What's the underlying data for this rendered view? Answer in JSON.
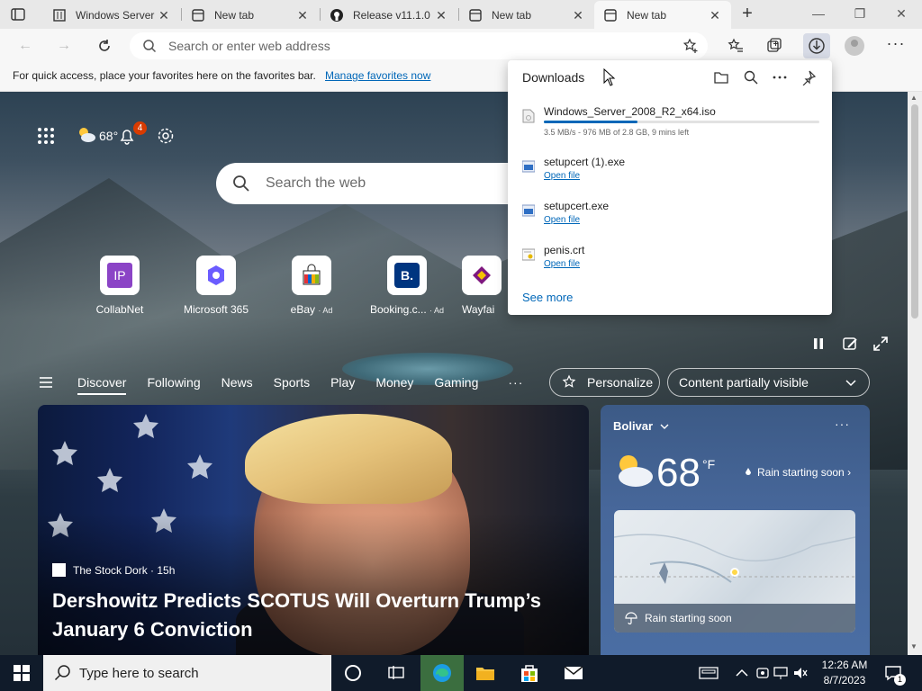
{
  "browser": {
    "tabs": [
      {
        "label": "Windows Server",
        "icon": "building-icon",
        "active": false
      },
      {
        "label": "New tab",
        "icon": "newtab-icon",
        "active": false
      },
      {
        "label": "Release v11.1.0",
        "icon": "github-icon",
        "active": false
      },
      {
        "label": "New tab",
        "icon": "newtab-icon",
        "active": false
      },
      {
        "label": "New tab",
        "icon": "newtab-icon",
        "active": true
      }
    ],
    "address_placeholder": "Search or enter web address",
    "favorites_bar": {
      "message": "For quick access, place your favorites here on the favorites bar.",
      "link": "Manage favorites now"
    },
    "accent": "#0067b8"
  },
  "downloads": {
    "title": "Downloads",
    "items": [
      {
        "name": "Windows_Server_2008_R2_x64.iso",
        "status": "3.5 MB/s - 976 MB of 2.8 GB, 9 mins left",
        "progress": 0.34
      },
      {
        "name": "setupcert (1).exe",
        "action": "Open file"
      },
      {
        "name": "setupcert.exe",
        "action": "Open file"
      },
      {
        "name": "penis.crt",
        "action": "Open file"
      }
    ],
    "see_more": "See more"
  },
  "newtab": {
    "weather_temp": "68°",
    "notification_count": "4",
    "search_placeholder": "Search the web",
    "quick_links": [
      {
        "label": "CollabNet",
        "ad": ""
      },
      {
        "label": "Microsoft 365",
        "ad": ""
      },
      {
        "label": "eBay",
        "ad": "· Ad"
      },
      {
        "label": "Booking.c...",
        "ad": "· Ad"
      },
      {
        "label": "Wayfai",
        "ad": ""
      }
    ],
    "feed_nav": [
      "Discover",
      "Following",
      "News",
      "Sports",
      "Play",
      "Money",
      "Gaming"
    ],
    "feed_more": "···",
    "personalize": "Personalize",
    "content_visibility": "Content partially visible",
    "hero": {
      "source": "The Stock Dork · 15h",
      "headline": "Dershowitz Predicts SCOTUS Will Overturn Trump’s January 6 Conviction"
    },
    "weather_card": {
      "location": "Bolivar",
      "temp": "68",
      "unit": "°F",
      "forecast": "Rain starting soon",
      "map_caption": "Rain starting soon"
    }
  },
  "taskbar": {
    "search_placeholder": "Type here to search",
    "time": "12:26 AM",
    "date": "8/7/2023",
    "notification_count": "1"
  }
}
